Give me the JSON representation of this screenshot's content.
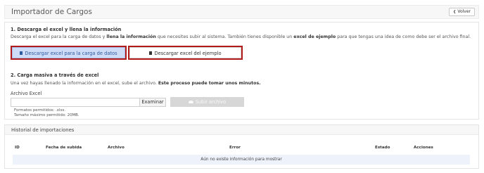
{
  "header": {
    "title": "Importador de Cargos",
    "back_label": "Volver"
  },
  "step1": {
    "title": "1. Descarga el excel y llena la información",
    "desc_a": "Descarga el excel para la carga de datos y ",
    "desc_b": "llena la información",
    "desc_c": " que necesites subir al sistema. También tienes disponible un ",
    "desc_d": "excel de ejemplo",
    "desc_e": " para que tengas una idea de como debe ser el archivo final.",
    "btn_template": "Descargar excel para la carga de datos",
    "btn_example": "Descargar excel del ejemplo"
  },
  "step2": {
    "title": "2. Carga masiva a través de excel",
    "desc_a": "Una vez hayas llenado la información en el excel, sube el archivo. ",
    "desc_b": "Este proceso puede tomar unos minutos.",
    "file_label": "Archivo Excel",
    "file_value": "",
    "browse_label": "Examinar",
    "upload_label": "Subir archivo",
    "formats": "Formatos permitidos: .xlsx.",
    "max_size": "Tamaño máximo permitido: 20MB."
  },
  "history": {
    "title": "Historial de importaciones",
    "columns": [
      "ID",
      "Fecha de subida",
      "Archivo",
      "Error",
      "Estado",
      "Acciones"
    ],
    "empty_message": "Aún no existe información para mostrar"
  },
  "colors": {
    "highlight": "#b11b1b",
    "primary_button": "#cfdcf7",
    "disabled_button": "#d7d7d7"
  }
}
